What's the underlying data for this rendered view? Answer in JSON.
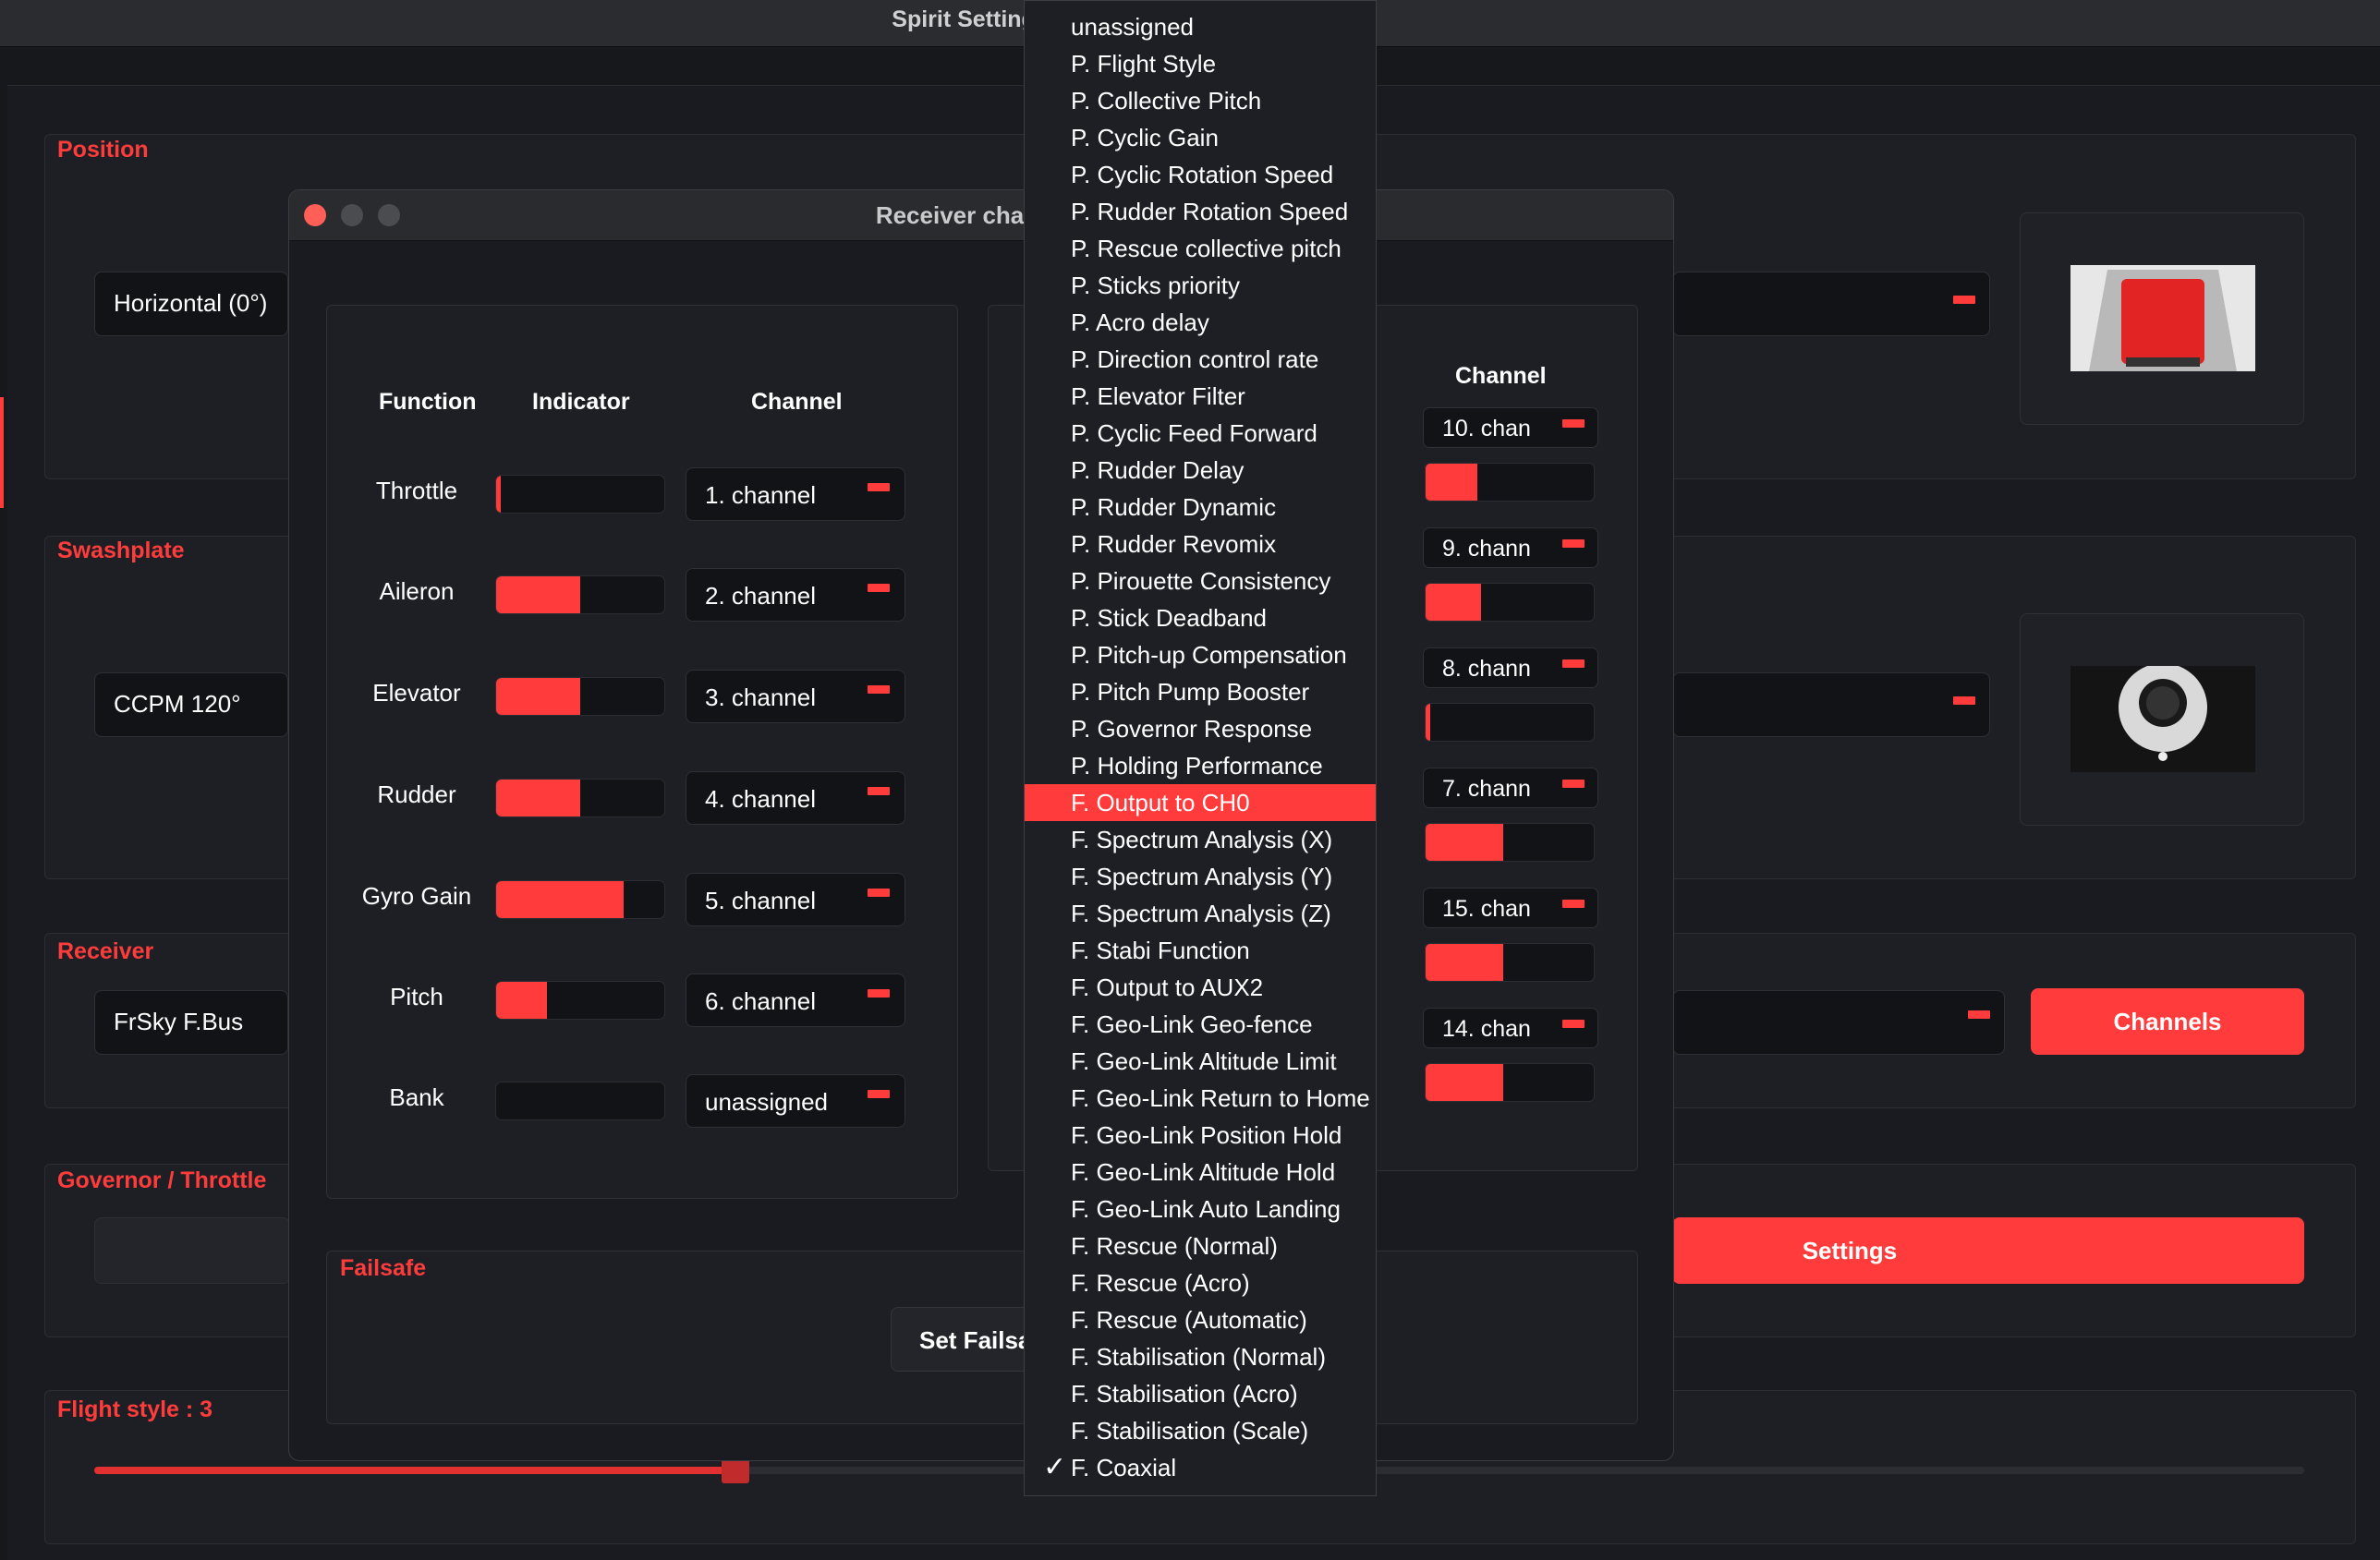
{
  "main_window": {
    "title": "Spirit Settings",
    "position": {
      "label": "Position",
      "value": "Horizontal (0°)"
    },
    "swashplate": {
      "label": "Swashplate",
      "value": "CCPM 120°"
    },
    "receiver": {
      "label": "Receiver",
      "value": "FrSky F.Bus",
      "channels_button": "Channels"
    },
    "governor": {
      "label": "Governor / Throttle",
      "settings_button": "Settings"
    },
    "flight_style": {
      "label": "Flight style : 3",
      "slider_fraction": 0.29
    }
  },
  "dialog": {
    "title": "Receiver channels",
    "headers": {
      "function": "Function",
      "indicator": "Indicator",
      "channel": "Channel"
    },
    "rows": [
      {
        "function": "Throttle",
        "level": 0.03,
        "channel": "1. channel"
      },
      {
        "function": "Aileron",
        "level": 0.5,
        "channel": "2. channel"
      },
      {
        "function": "Elevator",
        "level": 0.5,
        "channel": "3. channel"
      },
      {
        "function": "Rudder",
        "level": 0.5,
        "channel": "4. channel"
      },
      {
        "function": "Gyro Gain",
        "level": 0.76,
        "channel": "5. channel"
      },
      {
        "function": "Pitch",
        "level": 0.3,
        "channel": "6. channel"
      },
      {
        "function": "Bank",
        "level": 0.0,
        "channel": "unassigned"
      }
    ],
    "right_panel": {
      "header": "Channel",
      "rows": [
        {
          "channel": "10. chan",
          "level": 0.31
        },
        {
          "channel": "9. chann",
          "level": 0.33
        },
        {
          "channel": "8. chann",
          "level": 0.03
        },
        {
          "channel": "7. chann",
          "level": 0.46
        },
        {
          "channel": "15. chan",
          "level": 0.46
        },
        {
          "channel": "14. chan",
          "level": 0.46
        }
      ]
    },
    "failsafe": {
      "label": "Failsafe",
      "button": "Set Failsafe"
    }
  },
  "dropdown": {
    "selected": "F. Coaxial",
    "highlighted": "F. Output to CH0",
    "items": [
      "unassigned",
      "P. Flight Style",
      "P. Collective Pitch",
      "P. Cyclic Gain",
      "P. Cyclic Rotation Speed",
      "P. Rudder Rotation Speed",
      "P. Rescue collective pitch",
      "P. Sticks priority",
      "P. Acro delay",
      "P. Direction control rate",
      "P. Elevator Filter",
      "P. Cyclic Feed Forward",
      "P. Rudder Delay",
      "P. Rudder Dynamic",
      "P. Rudder Revomix",
      "P. Pirouette Consistency",
      "P. Stick Deadband",
      "P. Pitch-up Compensation",
      "P. Pitch Pump Booster",
      "P. Governor Response",
      "P. Holding Performance",
      "F. Output to CH0",
      "F. Spectrum Analysis (X)",
      "F. Spectrum Analysis (Y)",
      "F. Spectrum Analysis (Z)",
      "F. Stabi Function",
      "F. Output to AUX2",
      "F. Geo-Link Geo-fence",
      "F. Geo-Link Altitude Limit",
      "F. Geo-Link Return to Home",
      "F. Geo-Link Position Hold",
      "F. Geo-Link Altitude Hold",
      "F. Geo-Link Auto Landing",
      "F. Rescue (Normal)",
      "F. Rescue (Acro)",
      "F. Rescue (Automatic)",
      "F. Stabilisation (Normal)",
      "F. Stabilisation (Acro)",
      "F. Stabilisation (Scale)",
      "F. Coaxial"
    ]
  },
  "colors": {
    "accent": "#ff3b3b",
    "background": "#17181c",
    "panel": "#1d1f25"
  },
  "icons": {
    "checkmark": "✓"
  }
}
